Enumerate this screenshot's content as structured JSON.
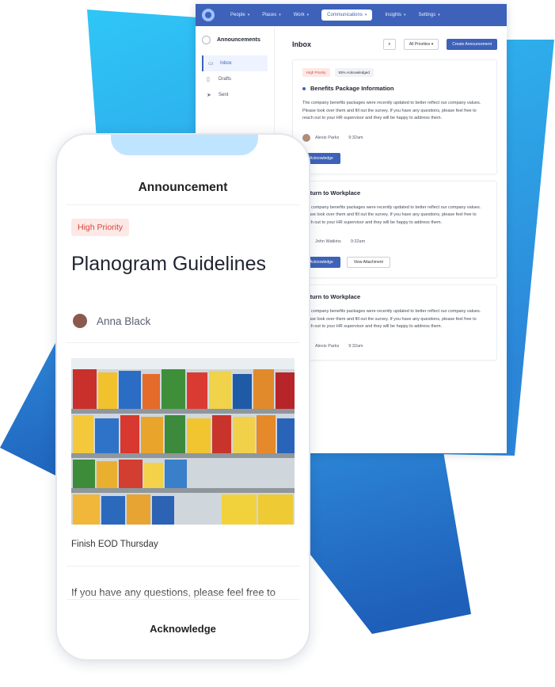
{
  "colors": {
    "brand_blue": "#3e62b9",
    "sky_gradient_top": "#2fc3f6",
    "sky_gradient_bottom": "#2f72c8",
    "high_priority_bg": "#fde8e6",
    "high_priority_text": "#d4493c"
  },
  "desktop": {
    "logo_icon": "app-logo-icon",
    "nav": [
      {
        "label": "People"
      },
      {
        "label": "Places"
      },
      {
        "label": "Work"
      },
      {
        "label": "Communications",
        "active": true
      },
      {
        "label": "Insights"
      },
      {
        "label": "Settings"
      }
    ],
    "sidebar": {
      "title": "Announcements",
      "items": [
        {
          "label": "Inbox",
          "icon": "inbox-icon",
          "active": true
        },
        {
          "label": "Drafts",
          "icon": "document-icon"
        },
        {
          "label": "Sent",
          "icon": "send-icon"
        }
      ]
    },
    "main": {
      "title": "Inbox",
      "search_icon": "search-icon",
      "filter_label": "All Priorities",
      "create_label": "Create Announcement"
    },
    "cards": [
      {
        "badge_priority": "High Priority",
        "badge_ack": "93% Acknowledged",
        "title": "Benefits Package Information",
        "body": "The company benefits packages were recently updated to better reflect our company values. Please look over them and fill out the survey. If you have any questions, please feel free to reach out to your HR supervisor and they will be happy to address them.",
        "author": "Alexis Parks",
        "time": "9:32am",
        "primary_action": "Acknowledge"
      },
      {
        "title": "Return to Workplace",
        "body": "The company benefits packages were recently updated to better reflect our company values. Please look over them and fill out the survey. If you have any questions, please feel free to reach out to your HR supervisor and they will be happy to address them.",
        "author": "John Watkins",
        "time": "9:32am",
        "primary_action": "Acknowledge",
        "secondary_action": "View Attachment"
      },
      {
        "title": "Return to Workplace",
        "body": "The company benefits packages were recently updated to better reflect our company values. Please look over them and fill out the survey. If you have any questions, please feel free to reach out to your HR supervisor and they will be happy to address them.",
        "author": "Alexis Parks",
        "time": "9:32am"
      }
    ]
  },
  "phone": {
    "header": "Announcement",
    "badge": "High Priority",
    "title": "Planogram Guidelines",
    "author": "Anna Black",
    "image_icon": "store-shelf-photo",
    "caption": "Finish EOD Thursday",
    "body": "If you have any questions, please feel free to",
    "action": "Acknowledge"
  }
}
